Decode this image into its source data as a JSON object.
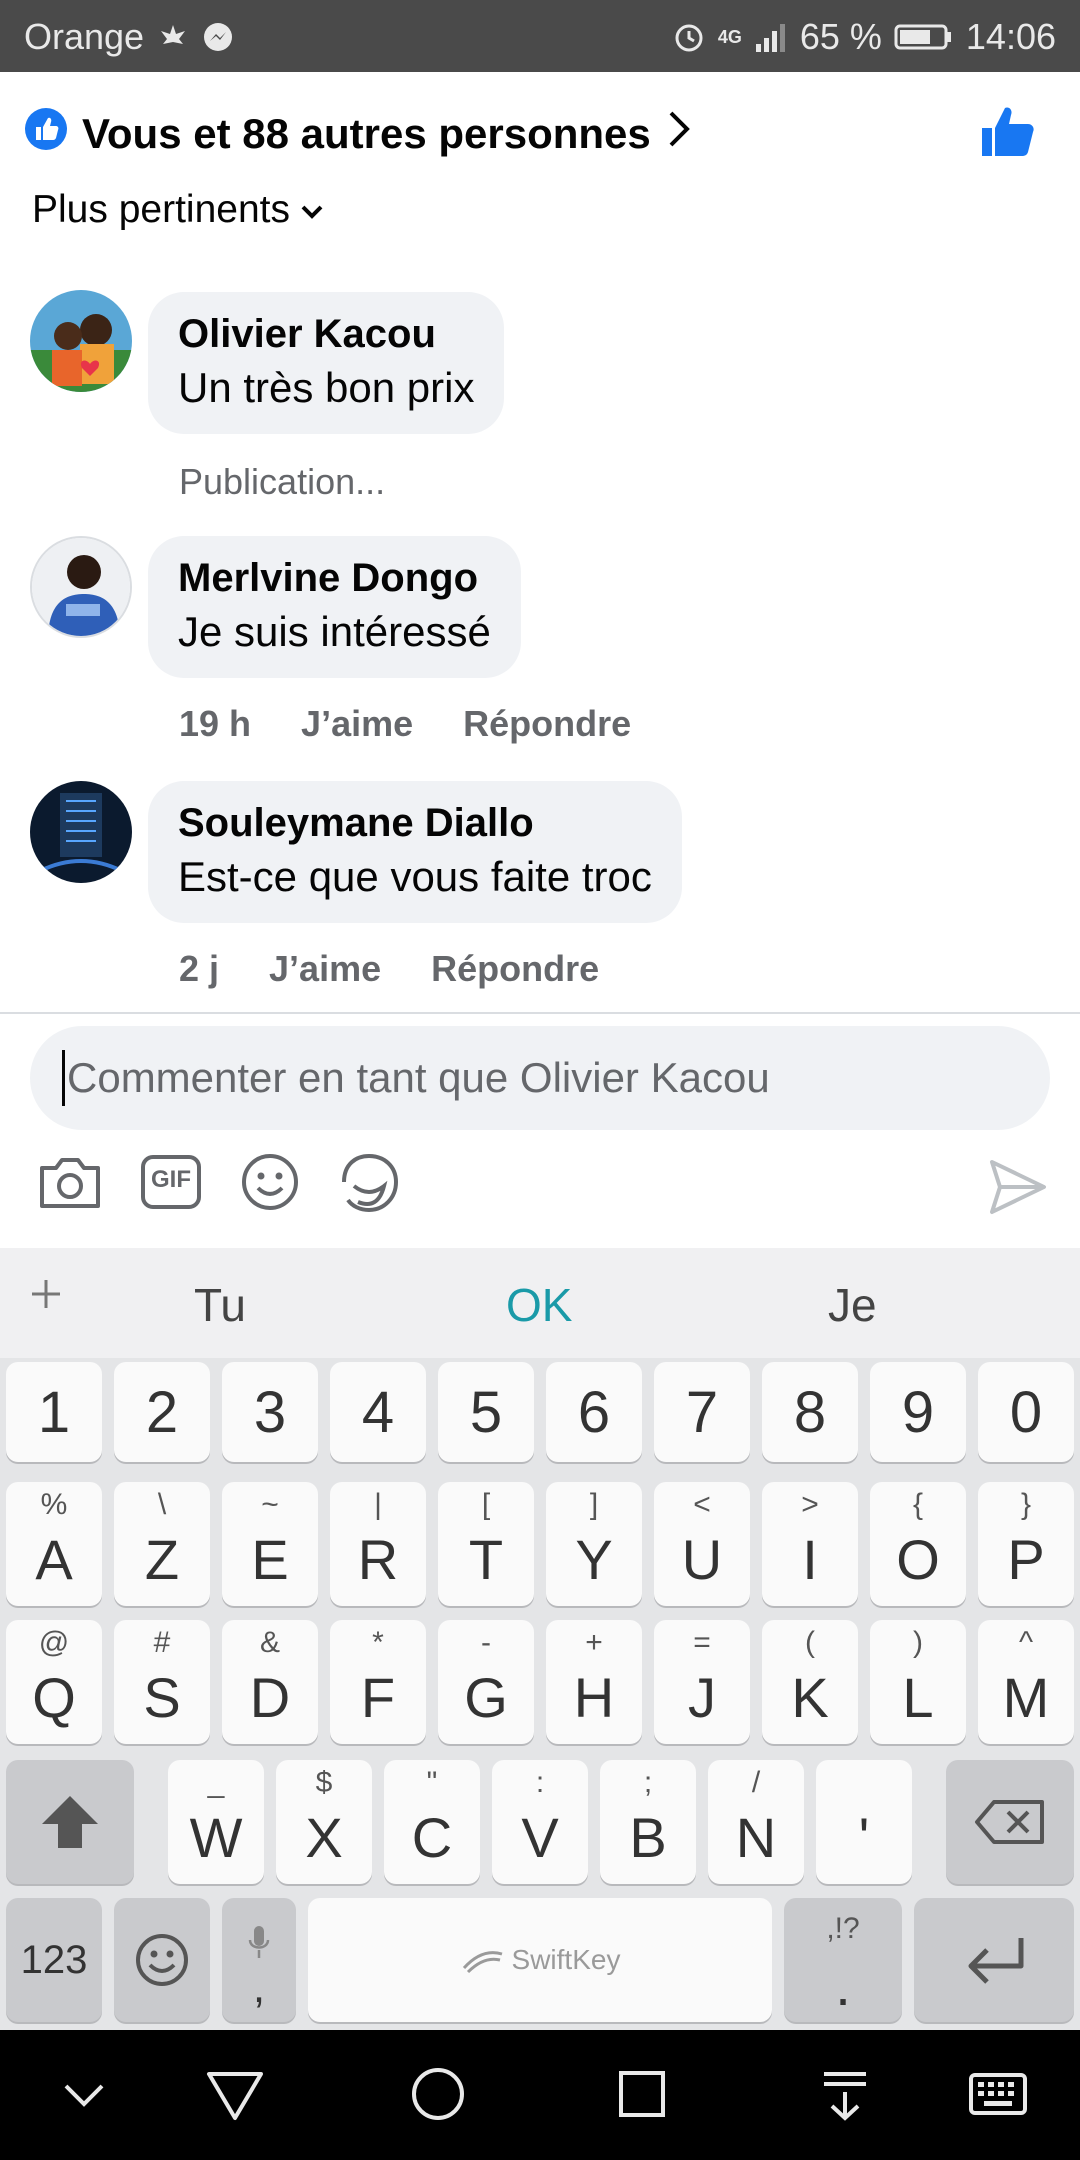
{
  "status_bar": {
    "carrier": "Orange",
    "network": "4G",
    "battery_percent": "65 %",
    "time": "14:06"
  },
  "header": {
    "reactions_text": "Vous et 88 autres personnes",
    "sort_label": "Plus pertinents"
  },
  "comments": [
    {
      "name": "Olivier Kacou",
      "text": "Un très bon prix",
      "status": "Publication..."
    },
    {
      "name": "Merlvine Dongo",
      "text": "Je suis intéressé",
      "time": "19 h",
      "like": "J’aime",
      "reply": "Répondre"
    },
    {
      "name": "Souleymane Diallo",
      "text": "Est-ce que vous faite troc",
      "time": "2 j",
      "like": "J’aime",
      "reply": "Répondre"
    }
  ],
  "composer": {
    "placeholder": "Commenter en tant que Olivier Kacou",
    "gif_label": "GIF"
  },
  "keyboard": {
    "suggestions": [
      "Tu",
      "OK",
      "Je"
    ],
    "accent_color": "#1a9aa8",
    "brand": "SwiftKey",
    "number_row": [
      "1",
      "2",
      "3",
      "4",
      "5",
      "6",
      "7",
      "8",
      "9",
      "0"
    ],
    "row1": [
      {
        "k": "A",
        "s": "%"
      },
      {
        "k": "Z",
        "s": "\\"
      },
      {
        "k": "E",
        "s": "~"
      },
      {
        "k": "R",
        "s": "|"
      },
      {
        "k": "T",
        "s": "["
      },
      {
        "k": "Y",
        "s": "]"
      },
      {
        "k": "U",
        "s": "<"
      },
      {
        "k": "I",
        "s": ">"
      },
      {
        "k": "O",
        "s": "{"
      },
      {
        "k": "P",
        "s": "}"
      }
    ],
    "row2": [
      {
        "k": "Q",
        "s": "@"
      },
      {
        "k": "S",
        "s": "#"
      },
      {
        "k": "D",
        "s": "&"
      },
      {
        "k": "F",
        "s": "*"
      },
      {
        "k": "G",
        "s": "-"
      },
      {
        "k": "H",
        "s": "+"
      },
      {
        "k": "J",
        "s": "="
      },
      {
        "k": "K",
        "s": "("
      },
      {
        "k": "L",
        "s": ")"
      },
      {
        "k": "M",
        "s": "^"
      }
    ],
    "row3": [
      {
        "k": "W",
        "s": "_"
      },
      {
        "k": "X",
        "s": "$"
      },
      {
        "k": "C",
        "s": "\""
      },
      {
        "k": "V",
        "s": ":"
      },
      {
        "k": "B",
        "s": ";"
      },
      {
        "k": "N",
        "s": "/"
      },
      {
        "k": "'",
        "s": ""
      }
    ],
    "numbers_key": "123",
    "comma_key": ",",
    "period_key": ".",
    "period_sub": ",!?"
  },
  "colors": {
    "facebook_blue": "#1877f2",
    "bubble_bg": "#f0f2f5",
    "meta_text": "#65676b"
  }
}
